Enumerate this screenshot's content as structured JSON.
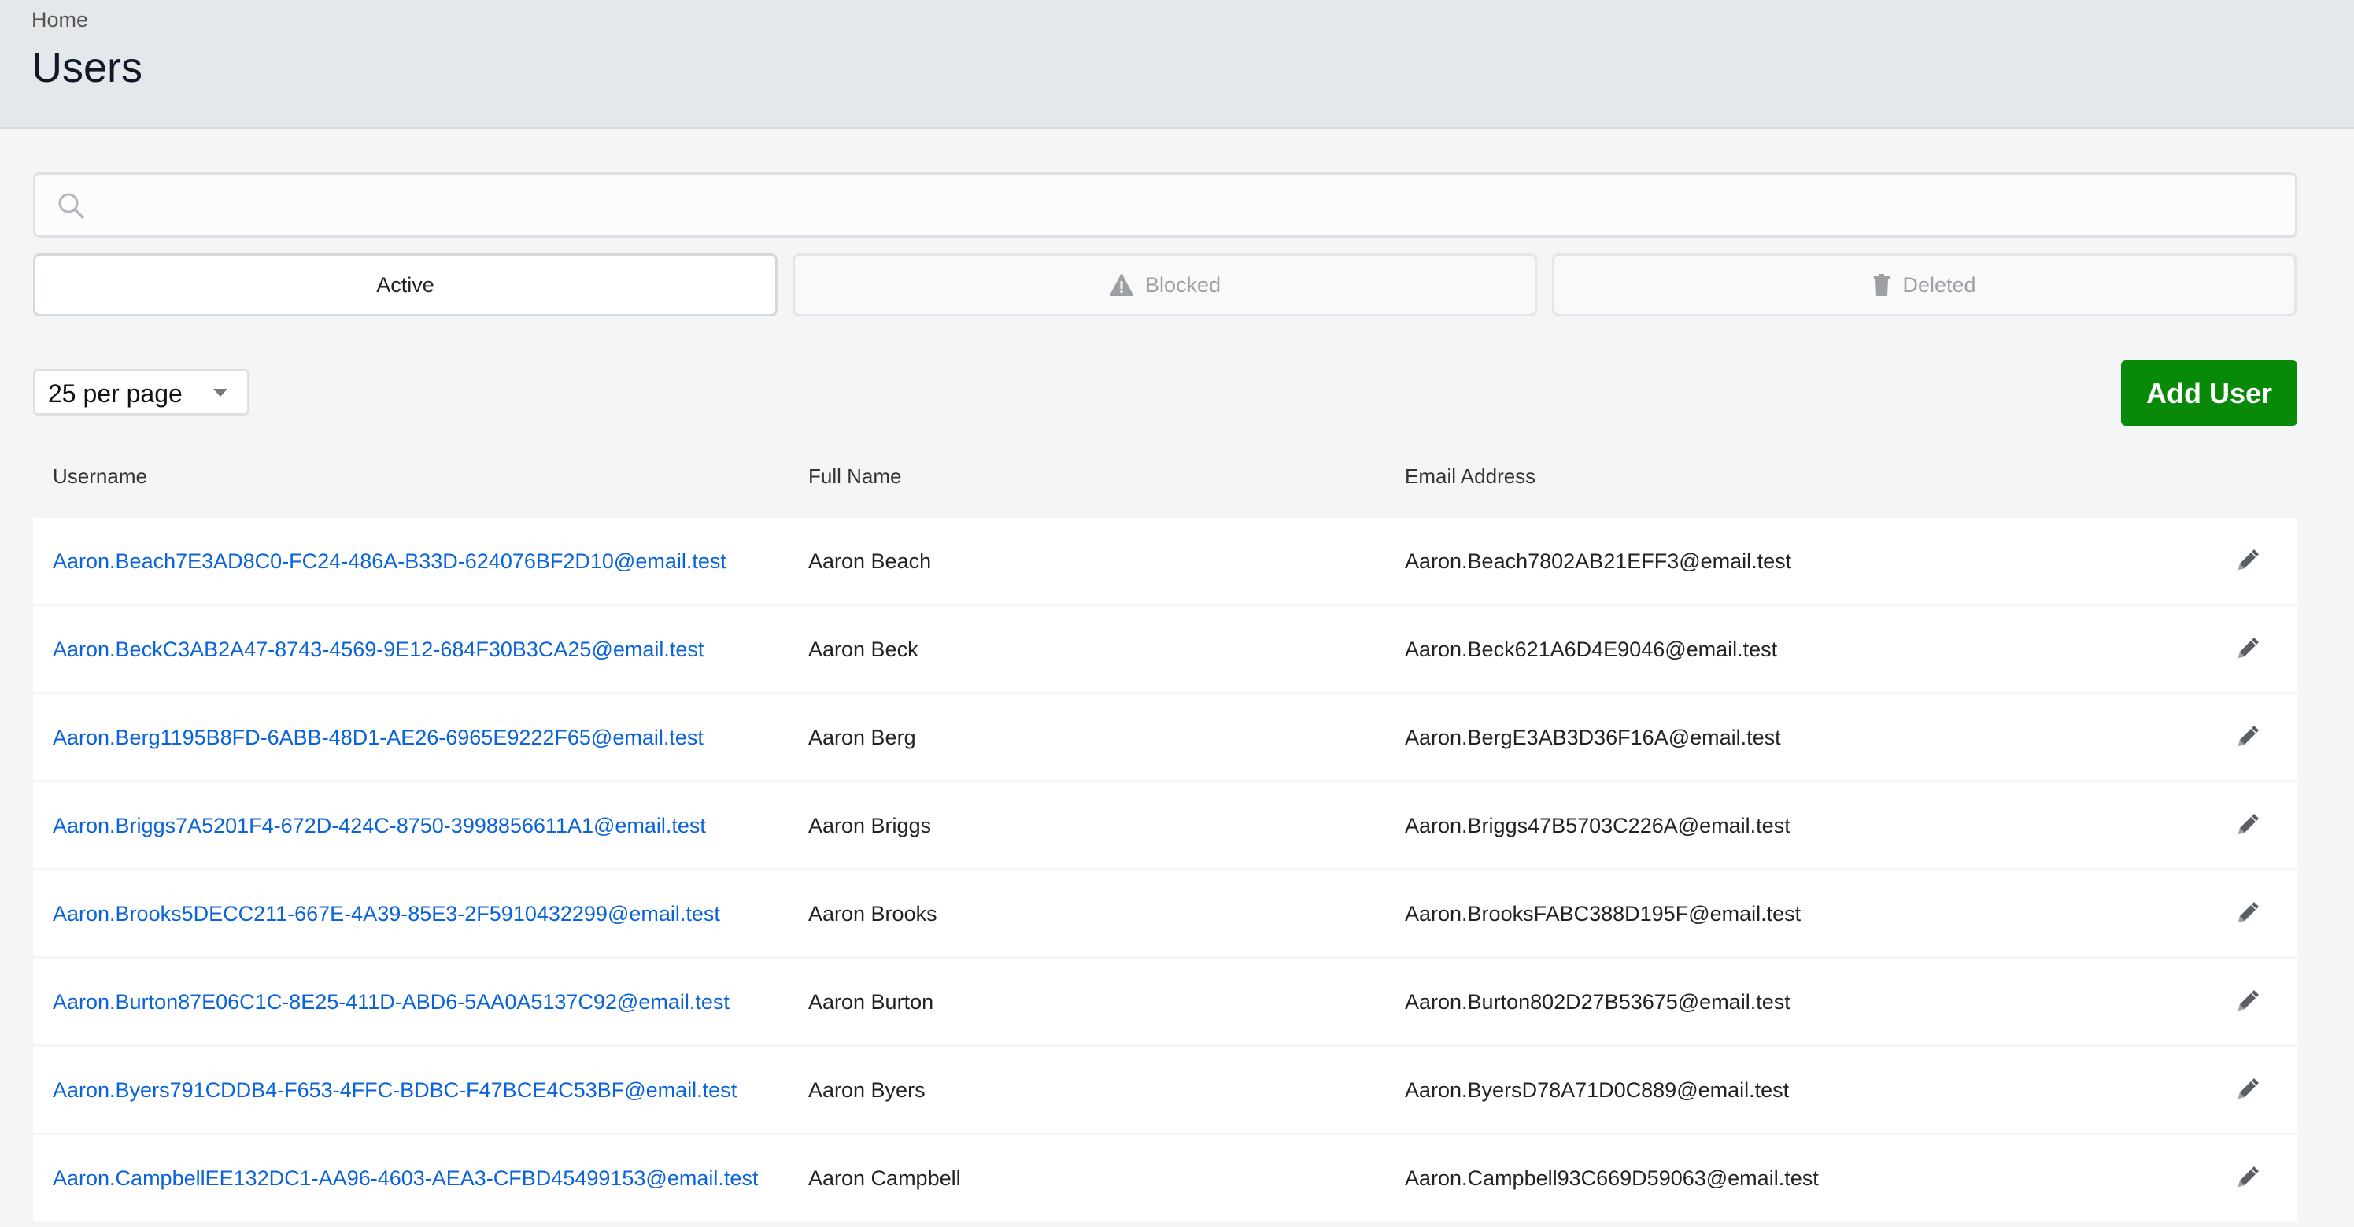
{
  "breadcrumb": "Home",
  "page_title": "Users",
  "search": {
    "value": "",
    "placeholder": ""
  },
  "tabs": [
    {
      "label": "Active",
      "icon": "none",
      "active": true
    },
    {
      "label": "Blocked",
      "icon": "warning-icon"
    },
    {
      "label": "Deleted",
      "icon": "trash-icon"
    }
  ],
  "per_page": "25 per page",
  "add_user": "Add User",
  "colors": {
    "accent": "#088a08",
    "link": "#0a63d8"
  },
  "columns": [
    "Username",
    "Full Name",
    "Email Address"
  ],
  "rows": [
    {
      "username": "Aaron.Beach7E3AD8C0-FC24-486A-B33D-624076BF2D10@email.test",
      "name": "Aaron Beach",
      "email": "Aaron.Beach7802AB21EFF3@email.test"
    },
    {
      "username": "Aaron.BeckC3AB2A47-8743-4569-9E12-684F30B3CA25@email.test",
      "name": "Aaron Beck",
      "email": "Aaron.Beck621A6D4E9046@email.test"
    },
    {
      "username": "Aaron.Berg1195B8FD-6ABB-48D1-AE26-6965E9222F65@email.test",
      "name": "Aaron Berg",
      "email": "Aaron.BergE3AB3D36F16A@email.test"
    },
    {
      "username": "Aaron.Briggs7A5201F4-672D-424C-8750-3998856611A1@email.test",
      "name": "Aaron Briggs",
      "email": "Aaron.Briggs47B5703C226A@email.test"
    },
    {
      "username": "Aaron.Brooks5DECC211-667E-4A39-85E3-2F5910432299@email.test",
      "name": "Aaron Brooks",
      "email": "Aaron.BrooksFABC388D195F@email.test"
    },
    {
      "username": "Aaron.Burton87E06C1C-8E25-411D-ABD6-5AA0A5137C92@email.test",
      "name": "Aaron Burton",
      "email": "Aaron.Burton802D27B53675@email.test"
    },
    {
      "username": "Aaron.Byers791CDDB4-F653-4FFC-BDBC-F47BCE4C53BF@email.test",
      "name": "Aaron Byers",
      "email": "Aaron.ByersD78A71D0C889@email.test"
    },
    {
      "username": "Aaron.CampbellEE132DC1-AA96-4603-AEA3-CFBD45499153@email.test",
      "name": "Aaron Campbell",
      "email": "Aaron.Campbell93C669D59063@email.test"
    }
  ]
}
